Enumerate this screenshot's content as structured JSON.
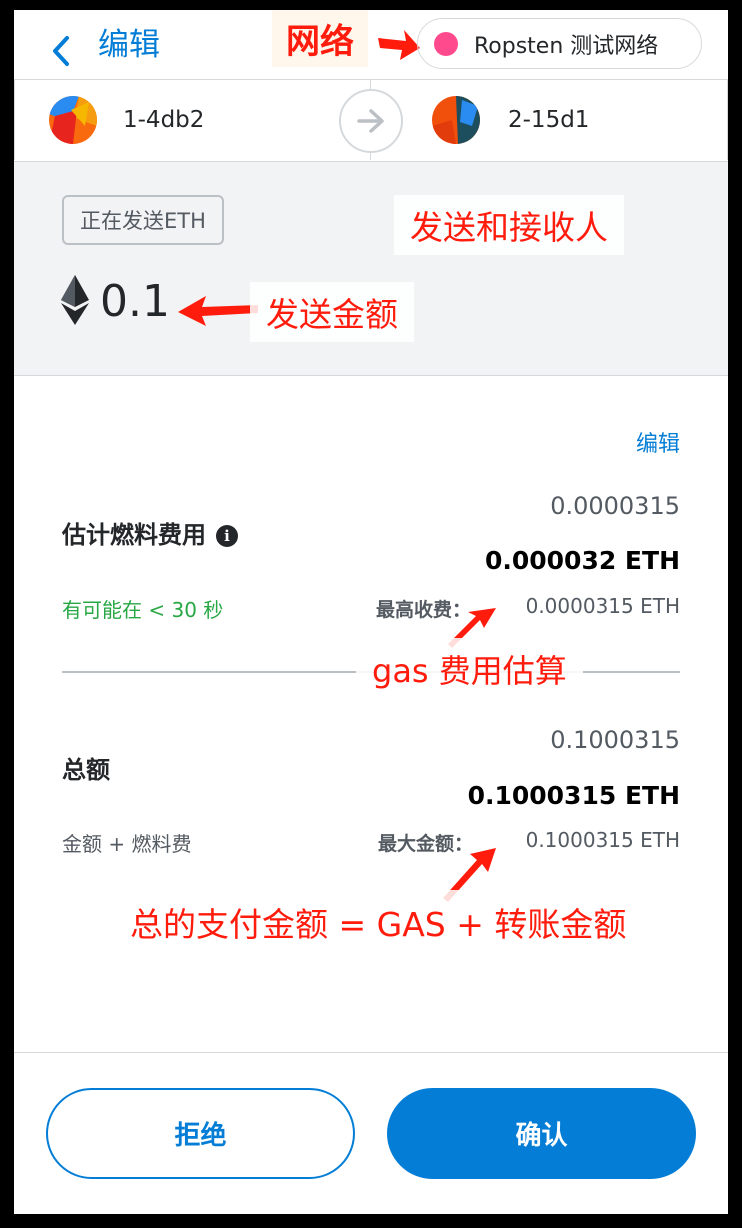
{
  "header": {
    "back_icon": "chevron-left-icon",
    "edit_label": "编辑",
    "network": {
      "label": "Ropsten 测试网络",
      "dot_color": "#ff4a8d"
    }
  },
  "parties": {
    "sender": {
      "name": "1-4db2"
    },
    "receiver": {
      "name": "2-15d1"
    },
    "arrow_icon": "arrow-right-icon"
  },
  "amount": {
    "badge": "正在发送ETH",
    "eth_icon": "ethereum-icon",
    "value": "0.1"
  },
  "details": {
    "edit_link": "编辑",
    "gas": {
      "label": "估计燃料费用",
      "info_icon": "info-icon",
      "value_secondary": "0.0000315",
      "value_primary": "0.000032 ETH",
      "time_estimate": "有可能在 < 30 秒",
      "max_fee_label": "最高收费：",
      "max_fee_value": "0.0000315 ETH"
    },
    "total": {
      "label": "总额",
      "value_secondary": "0.1000315",
      "value_primary": "0.1000315 ETH",
      "subtitle": "金额 + 燃料费",
      "max_amount_label": "最大金额：",
      "max_amount_value": "0.1000315 ETH"
    }
  },
  "footer": {
    "reject_label": "拒绝",
    "confirm_label": "确认"
  },
  "annotations": {
    "network": "网络",
    "parties": "发送和接收人",
    "amount": "发送金额",
    "gas": "gas 费用估算",
    "total": "总的支付金额 = GAS + 转账金额"
  },
  "colors": {
    "accent": "#037dd6",
    "annotation_red": "#ff1c0c",
    "success_green": "#28a745"
  }
}
